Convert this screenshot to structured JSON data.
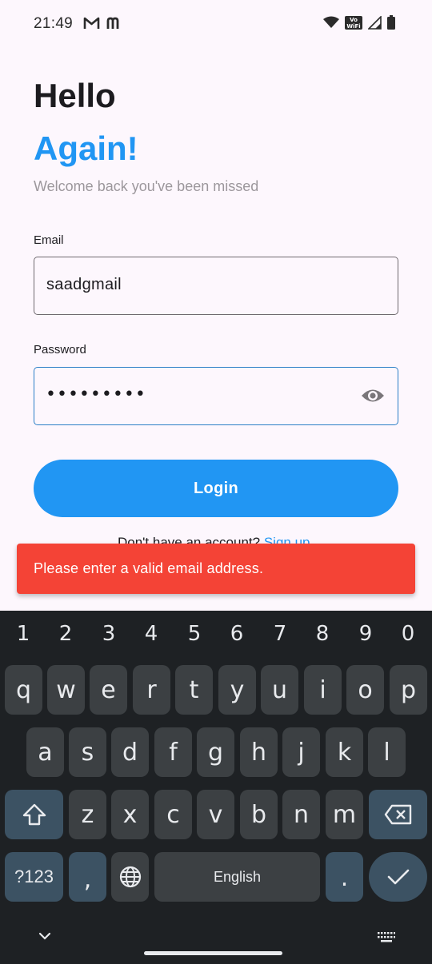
{
  "status_bar": {
    "time": "21:49",
    "left_icons": [
      "gmail-icon",
      "m-app-icon"
    ],
    "right_icons": [
      "wifi-icon",
      "vowifi-icon",
      "signal-icon",
      "battery-icon"
    ],
    "vowifi_line1": "Vo",
    "vowifi_line2": "WiFi"
  },
  "header": {
    "title_line1": "Hello",
    "title_line2": "Again!",
    "subtitle": "Welcome back you've been missed"
  },
  "form": {
    "email_label": "Email",
    "email_value": "saadgmail",
    "password_label": "Password",
    "password_value": "•••••••••",
    "login_label": "Login",
    "signup_prompt": "Don't have an account? ",
    "signup_link": "Sign up"
  },
  "snackbar": {
    "message": "Please enter a valid email address.",
    "color": "#f44336"
  },
  "keyboard": {
    "numbers": [
      "1",
      "2",
      "3",
      "4",
      "5",
      "6",
      "7",
      "8",
      "9",
      "0"
    ],
    "row1": [
      "q",
      "w",
      "e",
      "r",
      "t",
      "y",
      "u",
      "i",
      "o",
      "p"
    ],
    "row2": [
      "a",
      "s",
      "d",
      "f",
      "g",
      "h",
      "j",
      "k",
      "l"
    ],
    "row3": [
      "z",
      "x",
      "c",
      "v",
      "b",
      "n",
      "m"
    ],
    "symbols_label": "?123",
    "comma": ",",
    "space_label": "English",
    "period": "."
  },
  "colors": {
    "accent": "#2196f3",
    "background": "#fdf7fd",
    "keyboard_bg": "#1e2124"
  }
}
